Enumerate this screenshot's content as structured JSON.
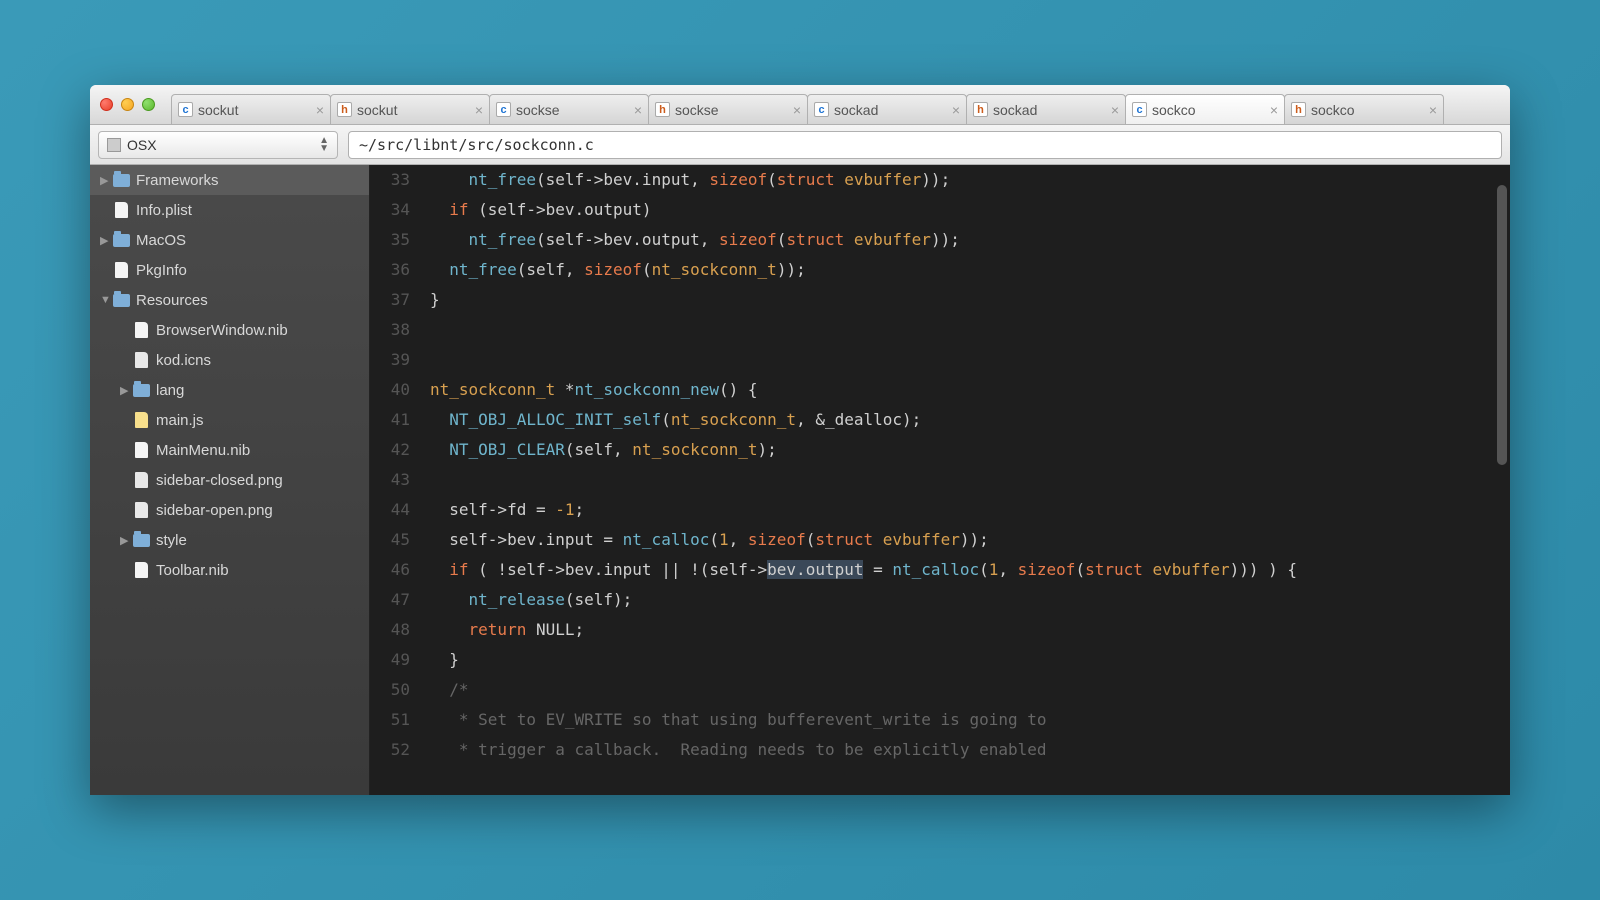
{
  "tabs": [
    {
      "icon": "c",
      "label": "sockut"
    },
    {
      "icon": "h",
      "label": "sockut"
    },
    {
      "icon": "c",
      "label": "sockse"
    },
    {
      "icon": "h",
      "label": "sockse"
    },
    {
      "icon": "c",
      "label": "sockad"
    },
    {
      "icon": "h",
      "label": "sockad"
    },
    {
      "icon": "c",
      "label": "sockco",
      "active": true
    },
    {
      "icon": "h",
      "label": "sockco"
    }
  ],
  "toolbar": {
    "dropdown_label": "OSX",
    "path": "~/src/libnt/src/sockconn.c"
  },
  "sidebar": [
    {
      "indent": 0,
      "kind": "folder",
      "label": "Frameworks",
      "arrow": "right",
      "selected": true
    },
    {
      "indent": 0,
      "kind": "file",
      "label": "Info.plist"
    },
    {
      "indent": 0,
      "kind": "folder",
      "label": "MacOS",
      "arrow": "right"
    },
    {
      "indent": 0,
      "kind": "file",
      "label": "PkgInfo"
    },
    {
      "indent": 0,
      "kind": "folder",
      "label": "Resources",
      "arrow": "down"
    },
    {
      "indent": 1,
      "kind": "file",
      "label": "BrowserWindow.nib"
    },
    {
      "indent": 1,
      "kind": "img",
      "label": "kod.icns"
    },
    {
      "indent": 1,
      "kind": "folder",
      "label": "lang",
      "arrow": "right"
    },
    {
      "indent": 1,
      "kind": "js",
      "label": "main.js"
    },
    {
      "indent": 1,
      "kind": "file",
      "label": "MainMenu.nib"
    },
    {
      "indent": 1,
      "kind": "img",
      "label": "sidebar-closed.png"
    },
    {
      "indent": 1,
      "kind": "img",
      "label": "sidebar-open.png"
    },
    {
      "indent": 1,
      "kind": "folder",
      "label": "style",
      "arrow": "right"
    },
    {
      "indent": 1,
      "kind": "file",
      "label": "Toolbar.nib"
    }
  ],
  "code": {
    "first_line": 33,
    "lines": [
      {
        "html": "    <span class='f'>nt_free</span>(self-&gt;bev.input, <span class='k'>sizeof</span>(<span class='k'>struct</span> <span class='t'>evbuffer</span>));"
      },
      {
        "html": "  <span class='k'>if</span> (self-&gt;bev.output)"
      },
      {
        "html": "    <span class='f'>nt_free</span>(self-&gt;bev.output, <span class='k'>sizeof</span>(<span class='k'>struct</span> <span class='t'>evbuffer</span>));"
      },
      {
        "html": "  <span class='f'>nt_free</span>(self, <span class='k'>sizeof</span>(<span class='t'>nt_sockconn_t</span>));"
      },
      {
        "html": "}"
      },
      {
        "html": " "
      },
      {
        "html": " "
      },
      {
        "html": "<span class='t'>nt_sockconn_t</span> *<span class='f'>nt_sockconn_new</span>() {"
      },
      {
        "html": "  <span class='f'>NT_OBJ_ALLOC_INIT_self</span>(<span class='t'>nt_sockconn_t</span>, &amp;_dealloc);"
      },
      {
        "html": "  <span class='f'>NT_OBJ_CLEAR</span>(self, <span class='t'>nt_sockconn_t</span>);"
      },
      {
        "html": " "
      },
      {
        "html": "  self-&gt;fd = <span class='n'>-1</span>;"
      },
      {
        "html": "  self-&gt;bev.input = <span class='f'>nt_calloc</span>(<span class='n'>1</span>, <span class='k'>sizeof</span>(<span class='k'>struct</span> <span class='t'>evbuffer</span>));"
      },
      {
        "html": "  <span class='k'>if</span> ( !self-&gt;bev.input || !(self-&gt;<span class='hl'>bev.output</span> = <span class='f'>nt_calloc</span>(<span class='n'>1</span>, <span class='k'>sizeof</span>(<span class='k'>struct</span> <span class='t'>evbuffer</span>))) ) {"
      },
      {
        "html": "    <span class='f'>nt_release</span>(self);"
      },
      {
        "html": "    <span class='k'>return</span> NULL;"
      },
      {
        "html": "  }"
      },
      {
        "html": "  <span class='c'>/*</span>"
      },
      {
        "html": "   <span class='c'>* Set to EV_WRITE so that using bufferevent_write is going to</span>"
      },
      {
        "html": "   <span class='c'>* trigger a callback.  Reading needs to be explicitly enabled</span>"
      }
    ]
  }
}
